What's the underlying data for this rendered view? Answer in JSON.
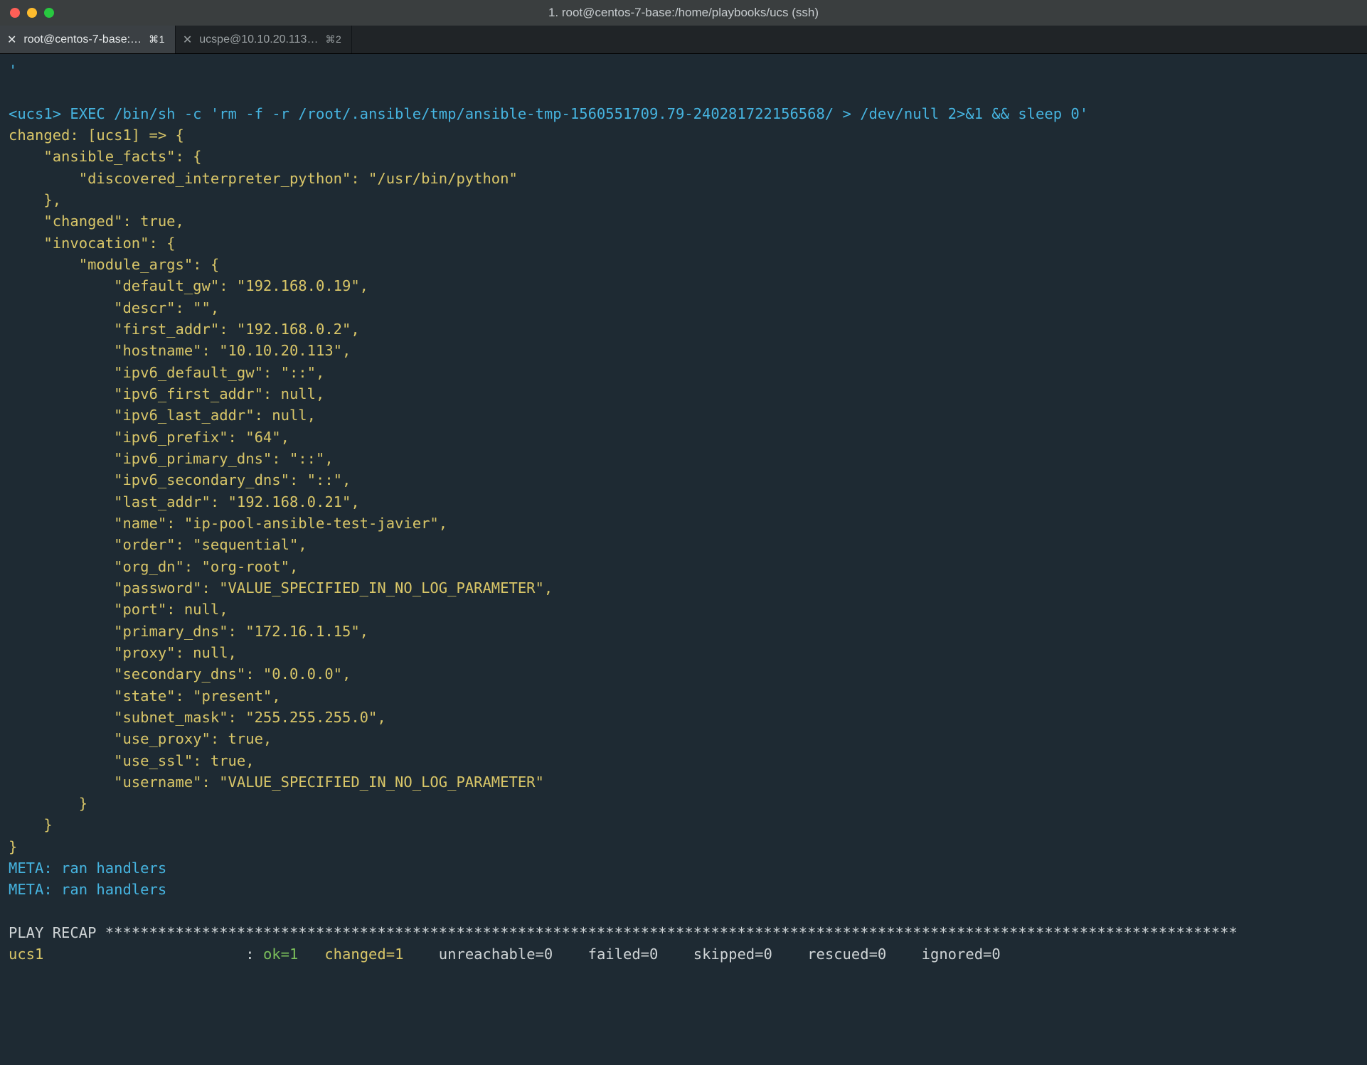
{
  "window": {
    "title": "1. root@centos-7-base:/home/playbooks/ucs (ssh)"
  },
  "tabs": [
    {
      "label": "root@centos-7-base:…",
      "shortcut": "⌘1",
      "active": true
    },
    {
      "label": "ucspe@10.10.20.113…",
      "shortcut": "⌘2",
      "active": false
    }
  ],
  "term": {
    "top_quote": "'",
    "exec_line": "<ucs1> EXEC /bin/sh -c 'rm -f -r /root/.ansible/tmp/ansible-tmp-1560551709.79-240281722156568/ > /dev/null 2>&1 && sleep 0'",
    "changed_line": "changed: [ucs1] => {",
    "json_body": "    \"ansible_facts\": {\n        \"discovered_interpreter_python\": \"/usr/bin/python\"\n    },\n    \"changed\": true,\n    \"invocation\": {\n        \"module_args\": {\n            \"default_gw\": \"192.168.0.19\",\n            \"descr\": \"\",\n            \"first_addr\": \"192.168.0.2\",\n            \"hostname\": \"10.10.20.113\",\n            \"ipv6_default_gw\": \"::\",\n            \"ipv6_first_addr\": null,\n            \"ipv6_last_addr\": null,\n            \"ipv6_prefix\": \"64\",\n            \"ipv6_primary_dns\": \"::\",\n            \"ipv6_secondary_dns\": \"::\",\n            \"last_addr\": \"192.168.0.21\",\n            \"name\": \"ip-pool-ansible-test-javier\",\n            \"order\": \"sequential\",\n            \"org_dn\": \"org-root\",\n            \"password\": \"VALUE_SPECIFIED_IN_NO_LOG_PARAMETER\",\n            \"port\": null,\n            \"primary_dns\": \"172.16.1.15\",\n            \"proxy\": null,\n            \"secondary_dns\": \"0.0.0.0\",\n            \"state\": \"present\",\n            \"subnet_mask\": \"255.255.255.0\",\n            \"use_proxy\": true,\n            \"use_ssl\": true,\n            \"username\": \"VALUE_SPECIFIED_IN_NO_LOG_PARAMETER\"\n        }\n    }\n}",
    "meta1": "META: ran handlers",
    "meta2": "META: ran handlers",
    "recap_header": "PLAY RECAP *********************************************************************************************************************************",
    "recap": {
      "host": "ucs1                       ",
      "sep": ": ",
      "ok": "ok=1   ",
      "changed": "changed=1   ",
      "unreachable": " unreachable=0   ",
      "failed": " failed=0   ",
      "skipped": " skipped=0   ",
      "rescued": " rescued=0   ",
      "ignored": " ignored=0   "
    }
  }
}
